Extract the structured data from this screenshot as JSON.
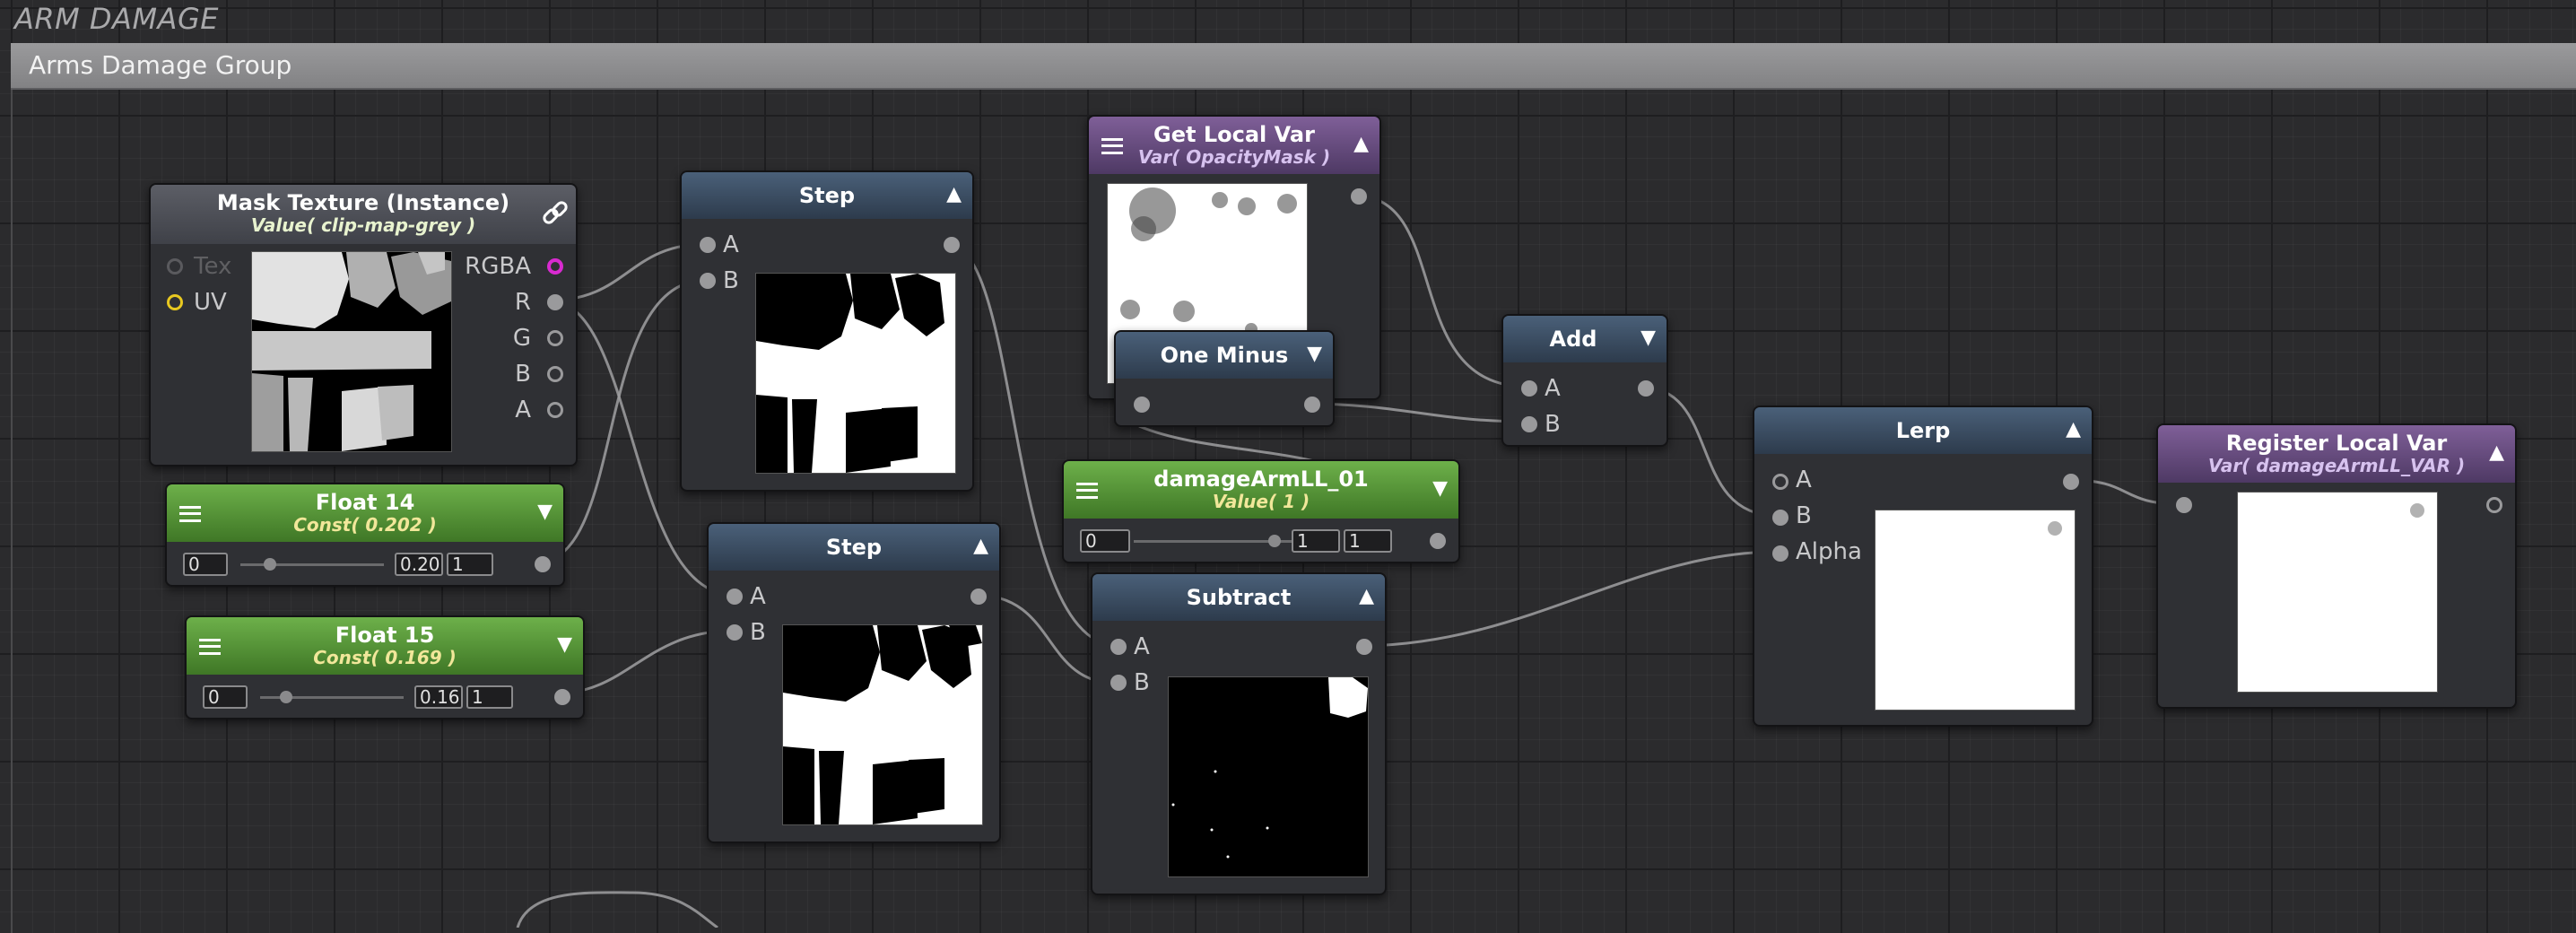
{
  "frame_title": "ARM DAMAGE",
  "group_title": "Arms Damage Group",
  "nodes": {
    "mask_texture": {
      "title": "Mask Texture (Instance)",
      "subtitle": "Value( clip-map-grey )",
      "inputs": [
        "Tex",
        "UV"
      ],
      "outputs": [
        "RGBA",
        "R",
        "G",
        "B",
        "A"
      ],
      "icon": "link-icon"
    },
    "float14": {
      "title": "Float 14",
      "subtitle": "Const( 0.202 )",
      "min": "0",
      "value": "0.20",
      "max": "1",
      "slider_fraction": 0.202
    },
    "float15": {
      "title": "Float 15",
      "subtitle": "Const( 0.169 )",
      "min": "0",
      "value": "0.16",
      "max": "1",
      "slider_fraction": 0.169
    },
    "step1": {
      "title": "Step",
      "inputs": [
        "A",
        "B"
      ]
    },
    "step2": {
      "title": "Step",
      "inputs": [
        "A",
        "B"
      ]
    },
    "get_local_var": {
      "title": "Get Local Var",
      "subtitle": "Var( OpacityMask )"
    },
    "one_minus": {
      "title": "One Minus"
    },
    "damage_arm": {
      "title": "damageArmLL_01",
      "subtitle": "Value( 1 )",
      "min": "0",
      "value": "1",
      "max": "1",
      "slider_fraction": 1
    },
    "subtract": {
      "title": "Subtract",
      "inputs": [
        "A",
        "B"
      ]
    },
    "add": {
      "title": "Add",
      "inputs": [
        "A",
        "B"
      ]
    },
    "lerp": {
      "title": "Lerp",
      "inputs": [
        "A",
        "B",
        "Alpha"
      ]
    },
    "register_local_var": {
      "title": "Register Local Var",
      "subtitle": "Var( damageArmLL_VAR )"
    }
  },
  "colors": {
    "purple_header": "#7f5f98",
    "green_header": "#6db04a",
    "blue_header": "#4a6079",
    "grey_header": "#5c5e66",
    "wire": "#a0a0a2",
    "uv_pin": "#e8c820",
    "rgba_pin": "#d82ad0"
  }
}
